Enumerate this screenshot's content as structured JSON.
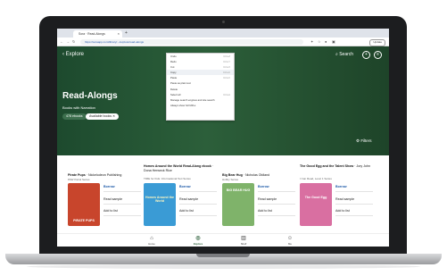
{
  "browser": {
    "tab_title": "Sora · Read-Alongs",
    "url": "https://soraapp.com/library/.../explore/read-alongs",
    "update_label": "Update"
  },
  "context_menu": {
    "items": [
      {
        "label": "Undo",
        "shortcut": "Ctrl+Z"
      },
      {
        "label": "Redo",
        "shortcut": "Ctrl+Y"
      },
      {
        "label": "Cut",
        "shortcut": "Ctrl+X"
      },
      {
        "label": "Copy",
        "shortcut": "Ctrl+C"
      },
      {
        "label": "Paste",
        "shortcut": "Ctrl+V"
      },
      {
        "label": "Paste as plain text",
        "shortcut": ""
      },
      {
        "label": "Delete",
        "shortcut": ""
      },
      {
        "label": "Select all",
        "shortcut": "Ctrl+A"
      },
      {
        "label": "Manage search engines and site search",
        "shortcut": ""
      },
      {
        "label": "Always show full URLs",
        "shortcut": ""
      }
    ]
  },
  "header": {
    "back_label": "‹ Explore",
    "search_label": "Search"
  },
  "hero": {
    "title": "Read-Alongs",
    "subtitle": "Books with Narration",
    "count_chip": "478 ebooks",
    "filter_chip": "Available books ✕",
    "filters_label": "Filters"
  },
  "books": [
    {
      "title": "Pirate Pups",
      "author": " · Nickelodeon Publishing",
      "meta": "PAW Patrol Series",
      "borrow": "Borrow",
      "sample": "Read sample",
      "add": "Add to list",
      "cover_label": "PIRATE PUPS",
      "cover_color": "#c8452c"
    },
    {
      "title": "Homes Around the World Read-Along ebook",
      "author": " · Dona Herweck Rice",
      "meta": "TIME for Kids: Informational Text Series",
      "borrow": "Borrow",
      "sample": "Read sample",
      "add": "Add to list",
      "cover_label": "Homes Around the World",
      "cover_color": "#3a9bd5"
    },
    {
      "title": "Big Bear Hug",
      "author": " · Nicholas Oldland",
      "meta": "Hobby Series",
      "borrow": "Borrow",
      "sample": "Read sample",
      "add": "Add to list",
      "cover_label": "BIG BEAR HUG",
      "cover_color": "#7fb36a"
    },
    {
      "title": "The Good Egg and the Talent Show",
      "author": " · Jory John",
      "meta": "I Can Read, Level 1 Series",
      "borrow": "Borrow",
      "sample": "Read sample",
      "add": "Add to list",
      "cover_label": "The Good Egg",
      "cover_color": "#d96fa1"
    }
  ],
  "bottom_nav": [
    {
      "label": "Home",
      "icon": "home-icon",
      "glyph": "⌂"
    },
    {
      "label": "Explore",
      "icon": "binoculars-icon",
      "glyph": "◎"
    },
    {
      "label": "Shelf",
      "icon": "shelf-icon",
      "glyph": "▥"
    },
    {
      "label": "Me",
      "icon": "user-icon",
      "glyph": "☺"
    }
  ],
  "colors": {
    "hero_bg": "#2c5f3a",
    "accent": "#1d5aa8"
  }
}
